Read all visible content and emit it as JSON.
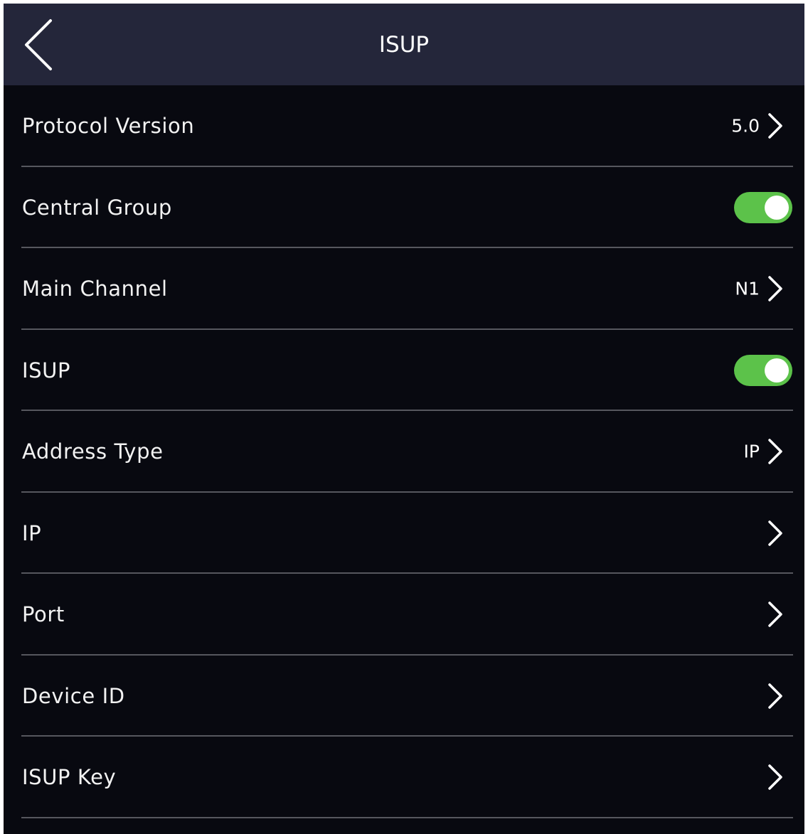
{
  "header": {
    "title": "ISUP"
  },
  "rows": [
    {
      "label": "Protocol Version",
      "value": "5.0"
    },
    {
      "label": "Central Group",
      "toggle": true
    },
    {
      "label": "Main Channel",
      "value": "N1"
    },
    {
      "label": "ISUP",
      "toggle": true
    },
    {
      "label": "Address Type",
      "value": "IP"
    },
    {
      "label": "IP",
      "value": ""
    },
    {
      "label": "Port",
      "value": ""
    },
    {
      "label": "Device ID",
      "value": ""
    },
    {
      "label": "ISUP Key",
      "value": ""
    }
  ],
  "colors": {
    "header_bg": "#24263a",
    "screen_bg": "#080910",
    "toggle_on": "#5cc24a",
    "divider": "#56575e"
  },
  "icons": {
    "back": "chevron-left-icon",
    "row_arrow": "chevron-right-icon"
  }
}
